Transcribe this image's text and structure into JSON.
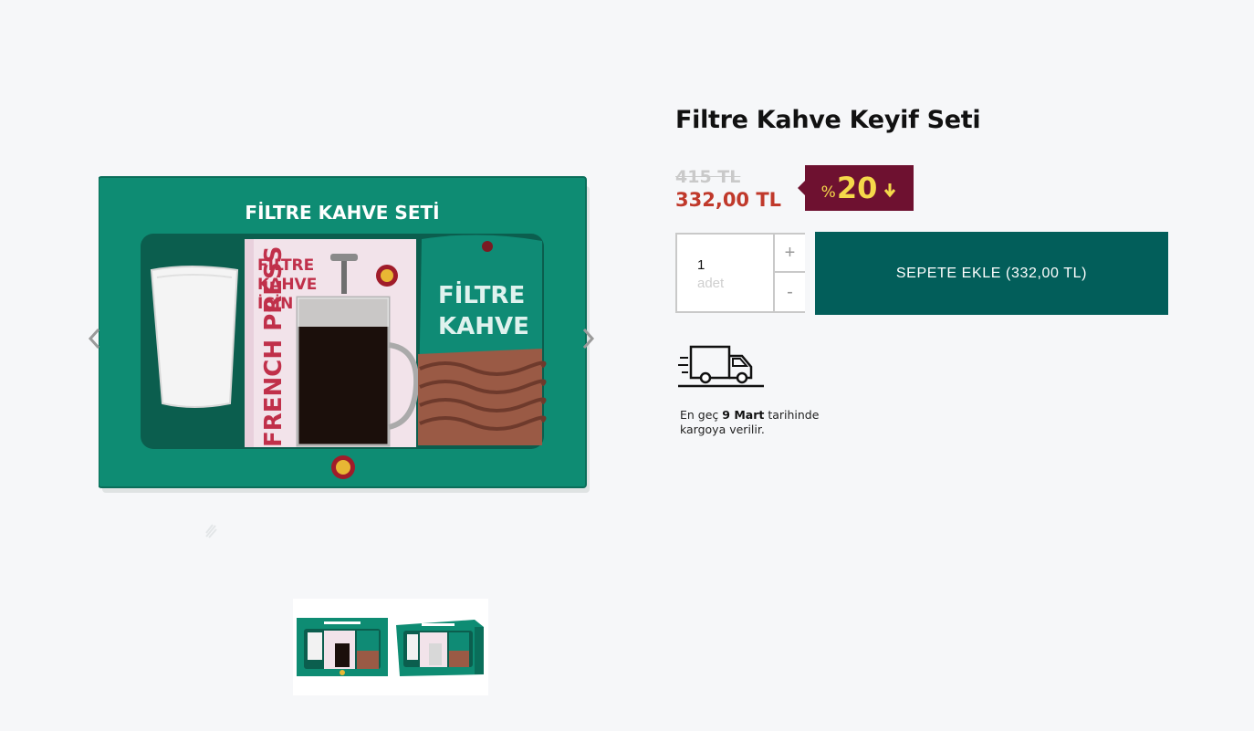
{
  "product": {
    "title": "Filtre Kahve Keyif Seti",
    "old_price": "415 TL",
    "new_price": "332,00 TL",
    "discount": {
      "percent_symbol": "%",
      "value": "20"
    }
  },
  "gallery": {
    "box_title": "FİLTRE KAHVE SETİ",
    "press_label_1": "FİLTRE",
    "press_label_2": "KAHVE",
    "press_label_3": "İÇİN",
    "press_side_text": "FRENCH PRESS",
    "bag_label_1": "FİLTRE",
    "bag_label_2": "KAHVE",
    "thumbnails": [
      "thumbnail-1",
      "thumbnail-2"
    ]
  },
  "quantity": {
    "value": "1",
    "unit": "adet",
    "plus": "+",
    "minus": "-"
  },
  "cart": {
    "button_label": "SEPETE EKLE (332,00 TL)"
  },
  "delivery": {
    "prefix": "En geç ",
    "date": "9 Mart",
    "suffix": " tarihinde",
    "line2": "kargoya verilir."
  },
  "colors": {
    "brand_green": "#025e5a",
    "badge": "#6e1130",
    "badge_text": "#f5d94a",
    "price_red": "#c0392b"
  }
}
